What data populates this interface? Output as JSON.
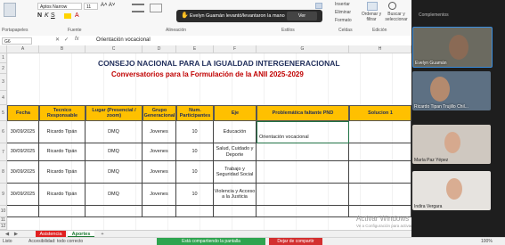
{
  "ribbon": {
    "font_name": "Aptos Narrow",
    "font_size": "11",
    "groups": [
      "Portapapeles",
      "Fuente",
      "Alineación",
      "Estilos",
      "Celdas",
      "Edición",
      "Complementos"
    ],
    "right_buttons": [
      "Insertar",
      "Eliminar",
      "Formato",
      "Ordenar y filtrar",
      "Buscar y seleccionar",
      "Complementos"
    ]
  },
  "notification": {
    "text": "Evelyn Guamán levantó/levantaron la mano",
    "button": "Ver"
  },
  "formula_bar": {
    "cell_ref": "G6",
    "fx": "fx",
    "content": "Orientación vocacional"
  },
  "columns": [
    "A",
    "B",
    "C",
    "D",
    "E",
    "F",
    "G",
    "H"
  ],
  "rows": [
    "1",
    "2",
    "3",
    "4",
    "5",
    "6",
    "7",
    "8",
    "9",
    "10",
    "11",
    "12"
  ],
  "sheet": {
    "title1": "CONSEJO NACIONAL PARA LA IGUALDAD INTERGENERACIONAL",
    "title2": "Conversatorios para la Formulación de la ANII 2025-2029",
    "headers": [
      "Fecha",
      "Tecnico Responsable",
      "Lugar (Presencial / zoom)",
      "Grupo Generacional",
      "Num. Participantes",
      "Eje",
      "Problemática faltante PND",
      "Solucion 1"
    ],
    "records": [
      {
        "fecha": "30/09/2025",
        "tecnico": "Ricardo Tipán",
        "lugar": "DMQ",
        "grupo": "Jovenes",
        "num": "10",
        "eje": "Educación",
        "problematica": "Orientación vocacional"
      },
      {
        "fecha": "30/09/2025",
        "tecnico": "Ricardo Tipán",
        "lugar": "DMQ",
        "grupo": "Jovenes",
        "num": "10",
        "eje": "Salud, Cuidado y Deporte",
        "problematica": ""
      },
      {
        "fecha": "30/09/2025",
        "tecnico": "Ricardo Tipán",
        "lugar": "DMQ",
        "grupo": "Jovenes",
        "num": "10",
        "eje": "Trabajo y Seguridad Social",
        "problematica": ""
      },
      {
        "fecha": "30/09/2025",
        "tecnico": "Ricardo Tipán",
        "lugar": "DMQ",
        "grupo": "Jovenes",
        "num": "10",
        "eje": "Violencia y Acceso a la Justicia",
        "problematica": ""
      }
    ]
  },
  "tabs": {
    "asistencia": "Asistencia",
    "aportes": "Aportes",
    "add": "+"
  },
  "status": {
    "listo": "Listo",
    "accesibilidad": "Accesibilidad: todo correcto",
    "sharing": "Está compartiendo la pantalla",
    "stop": "Dejar de compartir",
    "zoom": "100%"
  },
  "participants": [
    {
      "name": "Evelyn Guamán",
      "bg": "#6b6a60",
      "skin": "#8a6a55"
    },
    {
      "name": "Ricardo Tipan Trujillo Chil...",
      "bg": "#5d7083",
      "skin": "#b48a6e"
    },
    {
      "name": "María Paz Yépez",
      "bg": "#cfc8c0",
      "skin": "#d6a98e"
    },
    {
      "name": "Indira Vergara",
      "bg": "#e6e3df",
      "skin": "#d9ad92"
    }
  ],
  "watermark": {
    "line1": "Activar Windows",
    "line2": "Ve a Configuración para activar Windows."
  },
  "colors": {
    "header_fill": "#ffc000",
    "title_blue": "#1f2d5a",
    "title_red": "#c00000",
    "tab_red": "#e02020",
    "tab_green": "#1e7b34"
  }
}
